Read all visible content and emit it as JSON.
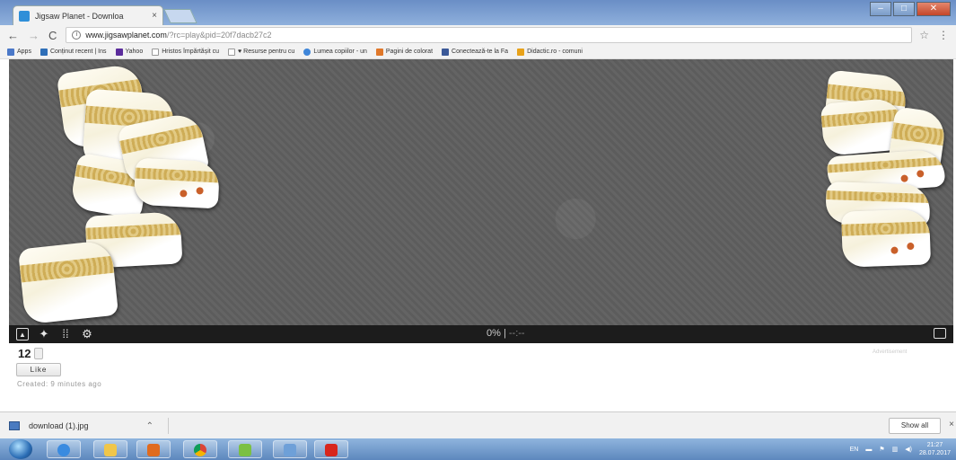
{
  "browser": {
    "tab_title": "Jigsaw Planet - Downloa",
    "tab_close": "×",
    "url_domain": "www.jigsawplanet.com",
    "url_path": "/?rc=play&pid=20f7dacb27c2",
    "star_icon": "star-icon"
  },
  "bookmarks": [
    {
      "label": "Apps",
      "color": "#4a78c8"
    },
    {
      "label": "Conținut recent | Ins",
      "color": "#2f6fb8"
    },
    {
      "label": "Yahoo",
      "color": "#5b2c9c"
    },
    {
      "label": "Hristos împărtășit cu",
      "color": "#999999"
    },
    {
      "label": "♥ Resurse pentru cu",
      "color": "#999999"
    },
    {
      "label": "Lumea copiilor - un",
      "color": "#3f86d9"
    },
    {
      "label": "Pagini de colorat",
      "color": "#e0782a"
    },
    {
      "label": "Conectează-te la Fa",
      "color": "#3b5998"
    },
    {
      "label": "Didactic.ro - comuni",
      "color": "#e8a21a"
    }
  ],
  "game": {
    "progress_text": "0%",
    "separator": "|",
    "timer_text": "--:--",
    "toolbar_icons": [
      "image-icon",
      "ghost-icon",
      "grid-icon",
      "settings-icon"
    ],
    "fullscreen_icon": "fullscreen-icon"
  },
  "social": {
    "like_count": "12",
    "like_label": "Like",
    "created_text": "Created: 9 minutes ago",
    "advertisement": "Advertisement"
  },
  "downloads": {
    "file_name": "download (1).jpg",
    "show_all": "Show all",
    "close": "×"
  },
  "taskbar": {
    "language": "EN",
    "time": "21:27",
    "date": "28.07.2017"
  }
}
